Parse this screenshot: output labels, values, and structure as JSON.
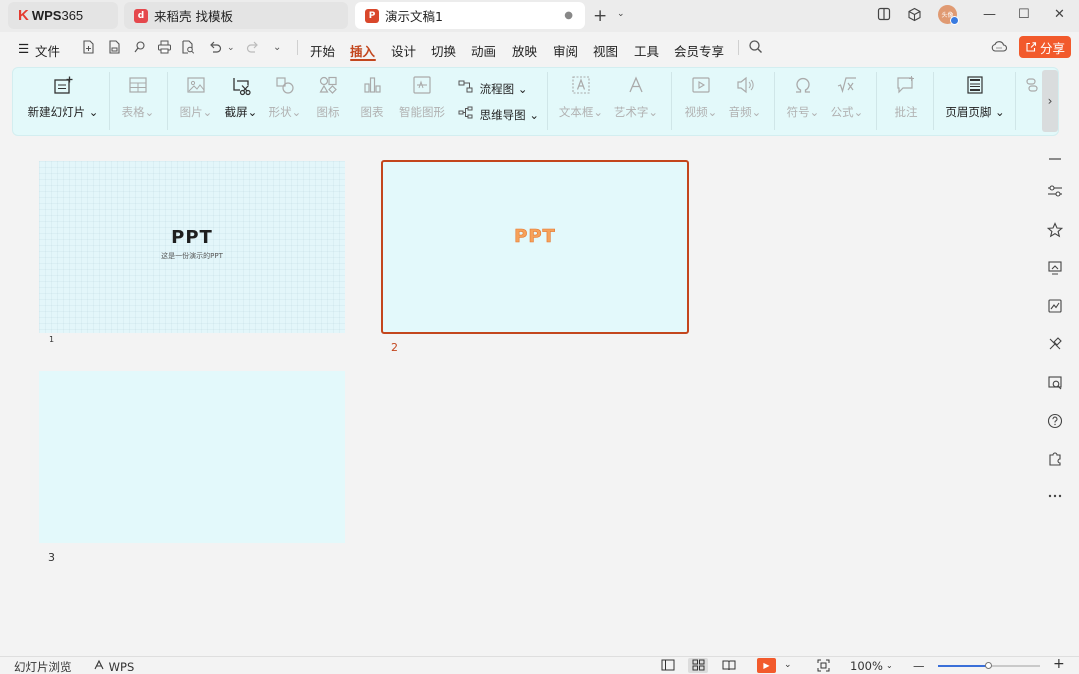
{
  "tabs": {
    "wps": {
      "logo": "K",
      "brand": "WPS",
      "suffix": "365"
    },
    "daoke": {
      "badge": "d",
      "label": "来稻壳 找模板",
      "badge_color": "#e5484d"
    },
    "doc": {
      "badge": "P",
      "label": "演示文稿1",
      "badge_color": "#d9472b",
      "dot": "●"
    },
    "new_tab": "+",
    "new_tab_arrow": "⌄"
  },
  "window": {
    "avatar_text": "头像",
    "minimize": "—",
    "maximize": "☐",
    "close": "✕"
  },
  "menu": {
    "hamburger": "☰",
    "file": "文件",
    "items": [
      "开始",
      "插入",
      "设计",
      "切换",
      "动画",
      "放映",
      "审阅",
      "视图",
      "工具",
      "会员专享"
    ],
    "active": "插入"
  },
  "share": {
    "label": "分享"
  },
  "ribbon": {
    "new_slide": "新建幻灯片",
    "table": "表格",
    "picture": "图片",
    "screenshot": "截屏",
    "shape": "形状",
    "icons": "图标",
    "chart": "图表",
    "smartart": "智能图形",
    "flowchart": "流程图",
    "mindmap": "思维导图",
    "textbox": "文本框",
    "wordart": "艺术字",
    "video": "视频",
    "audio": "音频",
    "symbol": "符号",
    "formula": "公式",
    "comment": "批注",
    "header_footer": "页眉页脚",
    "dropdown": "⌄",
    "scroll_right": "›"
  },
  "slides": [
    {
      "number": "1",
      "title": "PPT",
      "subtitle": "这是一份演示的PPT"
    },
    {
      "number": "2",
      "title": "PPT"
    },
    {
      "number": "3"
    }
  ],
  "statusbar": {
    "view_name": "幻灯片浏览",
    "wps_label": "WPS",
    "zoom": "100%",
    "zoom_level_fraction": 0.5,
    "zoom_minus": "—",
    "zoom_plus": "+"
  },
  "colors": {
    "accent": "#c3461d",
    "share": "#f25a2c",
    "ribbon_bg": "#e3f9fa",
    "slide_bg": "#e3f9fb"
  }
}
